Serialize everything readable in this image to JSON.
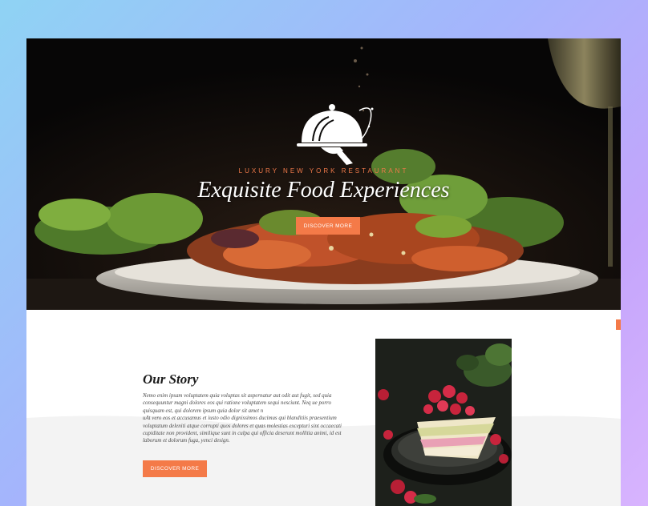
{
  "hero": {
    "eyebrow": "LUXURY NEW YORK RESTAURANT",
    "title": "Exquisite Food Experiences",
    "button_label": "DISCOVER MORE"
  },
  "story": {
    "title": "Our Story",
    "paragraph_1": "Nemo enim ipsam voluptatem quia voluptas sit aspernatur aut odit aut fugit, sed quia consequuntur magni dolores eos qui ratione voluptatem sequi nesciunt. Neq ue porro quisquam est, qui dolorem ipsum quia dolor sit amet n",
    "paragraph_2": "uAt vero eos et accusamus et iusto odio dignissimos ducimus qui blanditiis praesentium voluptatum deleniti atque corrupti quos dolores et quas molestias excepturi sint occaecati cupiditate non provident, similique sunt in culpa qui officia deserunt mollitia animi, id est laborum et dolorum fuga, yenci design.",
    "button_label": "DISCOVER MORE"
  },
  "colors": {
    "accent": "#f47a48",
    "hero_background": "#0c0b0a",
    "section_background": "#f4f4f4"
  },
  "icons": {
    "logo": "cloche-serving-hand-icon"
  }
}
